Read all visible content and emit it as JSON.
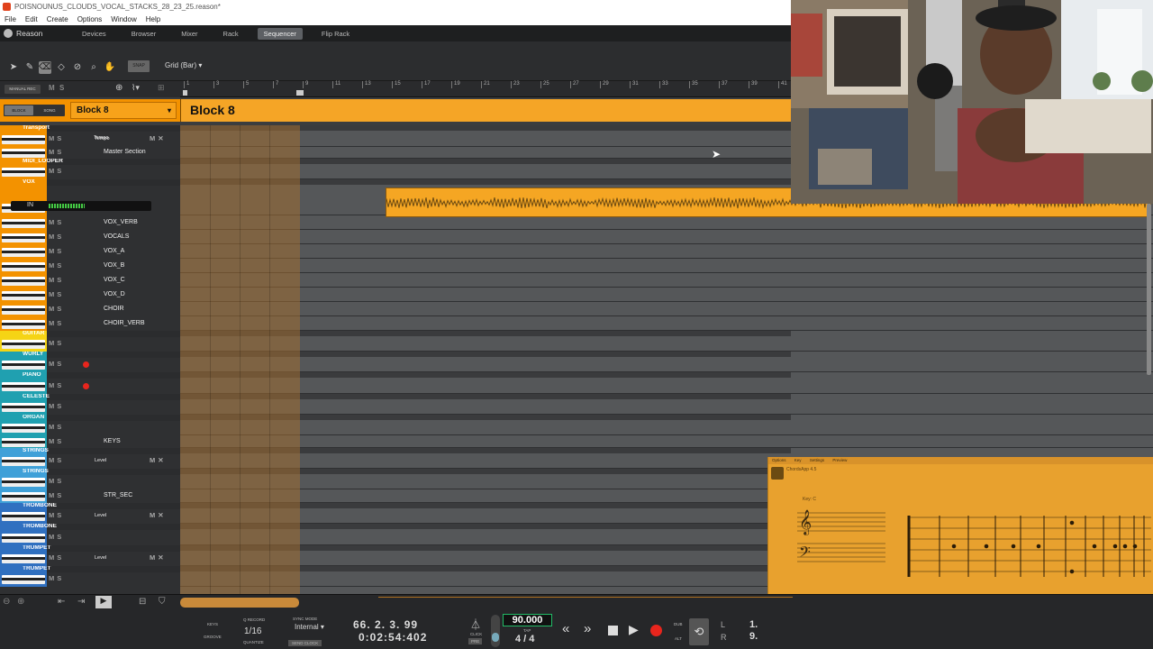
{
  "window": {
    "title": "POISNOUNUS_CLOUDS_VOCAL_STACKS_28_23_25.reason*"
  },
  "menu": [
    "File",
    "Edit",
    "Create",
    "Options",
    "Window",
    "Help"
  ],
  "nav": {
    "logo": "Reason",
    "tabs": [
      "Devices",
      "Browser",
      "Mixer",
      "Rack",
      "Sequencer",
      "Flip Rack"
    ],
    "active": "Sequencer"
  },
  "toolbar": {
    "snap_label": "SNAP",
    "grid": "Grid (Bar)",
    "manual_rec": "MANUAL REC",
    "m": "M",
    "s": "S"
  },
  "modes": {
    "block": "BLOCK",
    "song": "SONG"
  },
  "ruler": [
    "1",
    "3",
    "5",
    "7",
    "9",
    "11",
    "13",
    "15",
    "17",
    "19",
    "21",
    "23",
    "25",
    "27",
    "29",
    "31",
    "33",
    "35",
    "37",
    "39",
    "41"
  ],
  "block": {
    "selector": "Block 8",
    "lane_label": "Block 8"
  },
  "tracks": [
    {
      "group": "Transport",
      "name": "Tempo",
      "color": "#f39200",
      "lane": "Tempo"
    },
    {
      "group": "",
      "name": "Master Section",
      "color": "#f39200"
    },
    {
      "group": "MIDI_LOOPER",
      "name": "",
      "color": "#f39200"
    },
    {
      "group": "VOX",
      "name": "",
      "color": "#f39200",
      "input": "IN"
    },
    {
      "group": "",
      "name": "VOX_VERB",
      "color": "#f39200"
    },
    {
      "group": "",
      "name": "VOCALS",
      "color": "#f39200"
    },
    {
      "group": "",
      "name": "VOX_A",
      "color": "#f39200"
    },
    {
      "group": "",
      "name": "VOX_B",
      "color": "#f39200"
    },
    {
      "group": "",
      "name": "VOX_C",
      "color": "#f39200"
    },
    {
      "group": "",
      "name": "VOX_D",
      "color": "#f39200"
    },
    {
      "group": "",
      "name": "CHOIR",
      "color": "#f39200"
    },
    {
      "group": "",
      "name": "CHOIR_VERB",
      "color": "#f39200"
    },
    {
      "group": "GUITAR",
      "name": "",
      "color": "#f5d415"
    },
    {
      "group": "WURLY",
      "name": "",
      "color": "#20a0b0"
    },
    {
      "group": "PIANO",
      "name": "",
      "color": "#20a0b0"
    },
    {
      "group": "CELESTE",
      "name": "",
      "color": "#20a0b0"
    },
    {
      "group": "ORGAN",
      "name": "",
      "color": "#20a0b0"
    },
    {
      "group": "",
      "name": "KEYS",
      "color": "#20a0b0"
    },
    {
      "group": "STRINGS",
      "name": "",
      "color": "#3fa0d8",
      "lane": "Level"
    },
    {
      "group": "STRINGS",
      "name": "",
      "color": "#3fa0d8"
    },
    {
      "group": "",
      "name": "STR_SEC",
      "color": "#3fa0d8"
    },
    {
      "group": "TROMBONE",
      "name": "",
      "color": "#3070c0",
      "lane": "Level"
    },
    {
      "group": "TROMBONE",
      "name": "",
      "color": "#3070c0"
    },
    {
      "group": "TRUMPET",
      "name": "",
      "color": "#3070c0",
      "lane": "Level"
    },
    {
      "group": "TRUMPET",
      "name": "",
      "color": "#3070c0"
    }
  ],
  "transport": {
    "keys": "KEYS",
    "groove": "GROOVE",
    "q_record": "Q RECORD",
    "quantize_value": "1/16",
    "quantize": "QUANTIZE",
    "sync_mode": "SYNC MODE",
    "sync_value": "Internal",
    "send_clock": "SEND CLOCK",
    "position": "66. 2. 3. 99",
    "time": "0:02:54:402",
    "click": "CLICK",
    "pre": "PRE",
    "tempo": "90.000",
    "tap": "TAP",
    "signature": "4 / 4",
    "dub": "DUB",
    "alt": "ALT",
    "l": "L",
    "r": "R",
    "l_val": "1.",
    "r_val": "9."
  },
  "overlay": {
    "app_menu": [
      "Options",
      "Key",
      "Settings",
      "Preview"
    ],
    "app_title": "ChordsApp 4.5",
    "key_label": "Key: C"
  },
  "colors": {
    "accent": "#f39200",
    "bg": "#3b3d3f"
  }
}
